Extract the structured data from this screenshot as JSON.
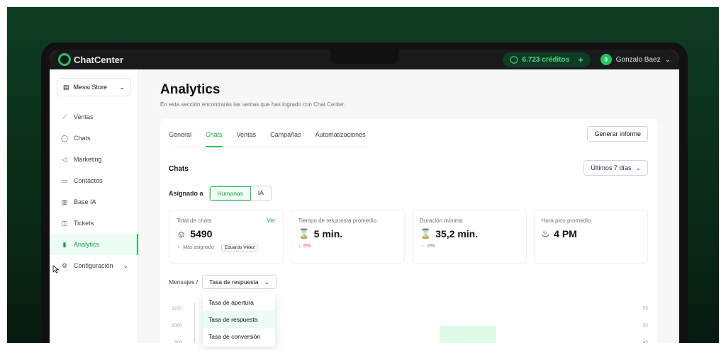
{
  "app": {
    "logo_text": "ChatCenter",
    "credits": "6.723 créditos",
    "user_badge": "0",
    "user_name": "Gonzalo Baez"
  },
  "sidebar": {
    "store": "Messi Store",
    "items": [
      {
        "label": "Ventas",
        "icon": "line-chart-icon"
      },
      {
        "label": "Chats",
        "icon": "chat-bubble-icon"
      },
      {
        "label": "Marketing",
        "icon": "megaphone-icon"
      },
      {
        "label": "Contactos",
        "icon": "contact-card-icon"
      },
      {
        "label": "Base IA",
        "icon": "database-icon"
      },
      {
        "label": "Tickets",
        "icon": "ticket-icon"
      },
      {
        "label": "Analytics",
        "icon": "bar-chart-icon",
        "active": true
      },
      {
        "label": "Configuración",
        "icon": "gear-icon"
      }
    ]
  },
  "page": {
    "title": "Analytics",
    "subtitle": "En esta sección encontrarás las ventas que has logrado con Chat Center.",
    "tabs": [
      "General",
      "Chats",
      "Ventas",
      "Campañas",
      "Automatizaciones"
    ],
    "active_tab": "Chats",
    "report_button": "Generar informe",
    "section_title": "Chats",
    "period": "Últimos 7 días",
    "assigned_label": "Asignado a",
    "assigned_options": [
      "Humanos",
      "IA"
    ],
    "assigned_selected": "Humanos"
  },
  "stats": [
    {
      "label": "Total de chats",
      "link": "Ver",
      "value": "5490",
      "icon": "chat-bubble-icon",
      "foot": "Más asignado",
      "foot_chip": "Eduardo Vélez",
      "foot_icon": "trophy-icon"
    },
    {
      "label": "Tiempo de respuesta promedio",
      "value": "5 min.",
      "icon": "hourglass-icon",
      "foot": "6%",
      "foot_icon": "arrow-down-icon"
    },
    {
      "label": "Duración mínima",
      "value": "35,2 min.",
      "icon": "hourglass-icon",
      "foot": "0%",
      "foot_icon": "dash-icon"
    },
    {
      "label": "Hora pico promedio",
      "value": "4 PM",
      "icon": "flame-icon"
    }
  ],
  "metrics": {
    "prefix": "Mensajes /",
    "selected": "Tasa de respuesta",
    "options": [
      "Tasa de apertura",
      "Tasa de respuesta",
      "Tasa de conversión"
    ]
  },
  "chart_axis": {
    "left_ticks": [
      "1100",
      "1000",
      "900"
    ],
    "right_ticks": [
      "55",
      "50",
      "45"
    ]
  },
  "colors": {
    "accent": "#22c55e",
    "brand_dark": "#0e3d22"
  }
}
